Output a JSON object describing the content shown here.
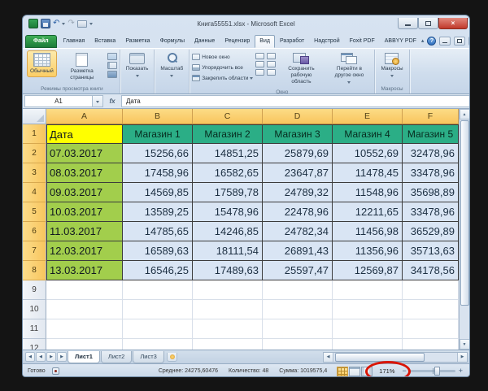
{
  "title_bar": {
    "title": "Книга55551.xlsx - Microsoft Excel"
  },
  "icons": {
    "dropdown": "▾",
    "undo": "↶",
    "redo": "↷",
    "help": "?",
    "collapse": "▴",
    "up": "▲",
    "down": "▼",
    "left": "◀",
    "right": "▶",
    "close": "×"
  },
  "tabs": {
    "file": "Файл",
    "items": [
      "Главная",
      "Вставка",
      "Разметка",
      "Формулы",
      "Данные",
      "Рецензир",
      "Вид",
      "Разработ",
      "Надстрой",
      "Foxit PDF",
      "ABBYY PDF"
    ],
    "active": "Вид"
  },
  "ribbon": {
    "view_modes": {
      "normal": "Обычный",
      "page_layout": "Разметка страницы",
      "group_label": "Режимы просмотра книги"
    },
    "show_button": "Показать",
    "zoom_button": "Масштаб",
    "window": {
      "new_window": "Новое окно",
      "arrange_all": "Упорядочить все",
      "freeze_panes": "Закрепить области",
      "save_workspace": "Сохранить рабочую область",
      "switch_window": "Перейти в другое окно",
      "group_label": "Окно"
    },
    "macros": {
      "button": "Макросы",
      "group_label": "Макросы"
    }
  },
  "formula_bar": {
    "name_box": "A1",
    "fx": "fx",
    "content": "Дата"
  },
  "grid": {
    "columns": [
      "A",
      "B",
      "C",
      "D",
      "E",
      "F"
    ],
    "row_numbers": [
      "1",
      "2",
      "3",
      "4",
      "5",
      "6",
      "7",
      "8",
      "9",
      "10",
      "11",
      "12"
    ],
    "header_row": [
      "Дата",
      "Магазин 1",
      "Магазин 2",
      "Магазин 3",
      "Магазин 4",
      "Магазин 5"
    ],
    "rows": [
      {
        "date": "07.03.2017",
        "values": [
          "15256,66",
          "14851,25",
          "25879,69",
          "10552,69",
          "32478,96"
        ]
      },
      {
        "date": "08.03.2017",
        "values": [
          "17458,96",
          "16582,65",
          "23647,87",
          "11478,45",
          "33478,96"
        ]
      },
      {
        "date": "09.03.2017",
        "values": [
          "14569,85",
          "17589,78",
          "24789,32",
          "11548,96",
          "35698,89"
        ]
      },
      {
        "date": "10.03.2017",
        "values": [
          "13589,25",
          "15478,96",
          "22478,96",
          "12211,65",
          "33478,96"
        ]
      },
      {
        "date": "11.03.2017",
        "values": [
          "14785,65",
          "14246,85",
          "24782,34",
          "11456,98",
          "36529,89"
        ]
      },
      {
        "date": "12.03.2017",
        "values": [
          "16589,63",
          "18111,54",
          "26891,43",
          "11356,96",
          "35713,63"
        ]
      },
      {
        "date": "13.03.2017",
        "values": [
          "16546,25",
          "17489,63",
          "25597,47",
          "12569,87",
          "34178,56"
        ]
      }
    ]
  },
  "sheet_tabs": {
    "items": [
      "Лист1",
      "Лист2",
      "Лист3"
    ],
    "active": "Лист1"
  },
  "status_bar": {
    "ready": "Готово",
    "average": "Среднее: 24275,60476",
    "count": "Количество: 48",
    "sum": "Сумма: 1019575,4",
    "zoom_level": "171%"
  },
  "colors": {
    "selection_amber": "#F8C55E",
    "shop_header_green": "#2BAE86",
    "date_cell_green": "#A2CE4C",
    "date_header_yellow": "#FFFF00",
    "data_cell_blue": "#D9E5F4",
    "annotation_red": "#DA1504",
    "file_tab_green": "#1C7C38"
  }
}
